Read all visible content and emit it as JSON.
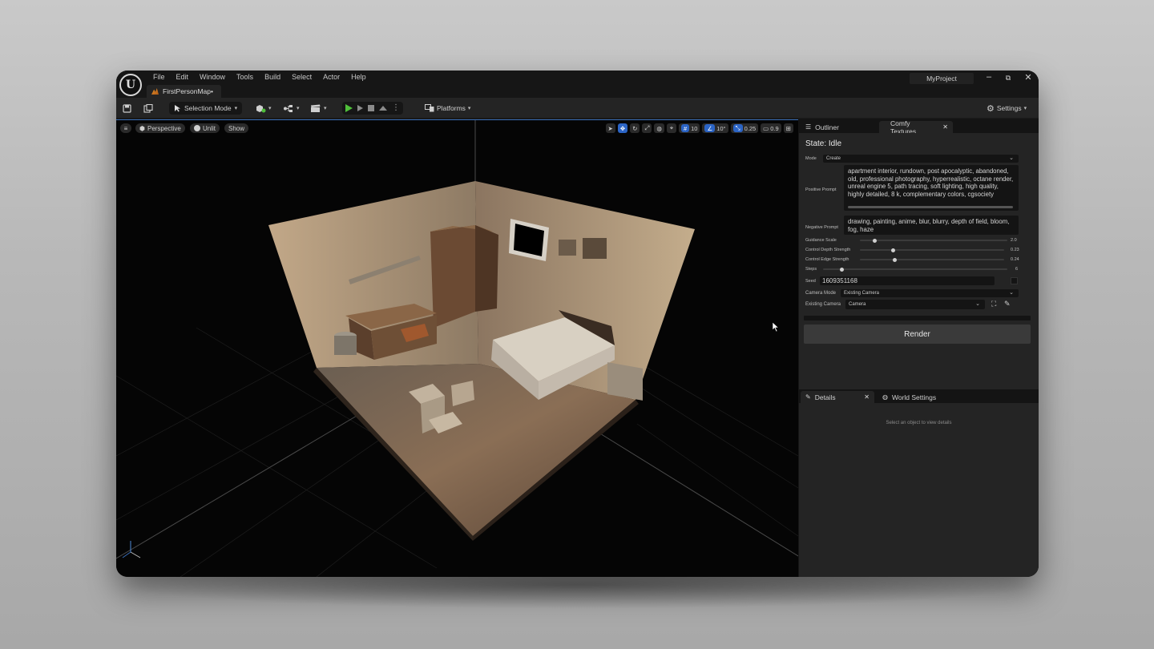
{
  "menu": [
    "File",
    "Edit",
    "Window",
    "Tools",
    "Build",
    "Select",
    "Actor",
    "Help"
  ],
  "map_tab": "FirstPersonMap•",
  "project_name": "MyProject",
  "window_controls": {
    "minimize": "–",
    "restore": "⧉",
    "close": "✕"
  },
  "toolbar": {
    "selection_mode": "Selection Mode",
    "platforms": "Platforms",
    "settings": "Settings"
  },
  "viewport": {
    "perspective": "Perspective",
    "unlit": "Unlit",
    "show": "Show",
    "grid_snap": "10",
    "rotation_snap": "10°",
    "scale_snap": "0.25",
    "camera_speed": "0.9"
  },
  "panel": {
    "outliner_tab": "Outliner",
    "comfy_tab": "Comfy Textures...",
    "state": "State: Idle",
    "mode_label": "Mode",
    "mode_value": "Create",
    "positive_label": "Positive Prompt",
    "positive_prompt": "apartment interior, rundown, post apocalyptic, abandoned, old, professional photography, hyperrealistic, octane render, unreal engine 5, path tracing, soft lighting, high quality, highly detailed, 8 k, complementary colors, cgsociety",
    "negative_label": "Negative Prompt",
    "negative_prompt": "drawing, painting, anime, blur, blurry, depth of field, bloom, fog, haze",
    "guidance_label": "Guidance Scale",
    "guidance_value": "2.0",
    "guidance_fraction": 0.1,
    "depth_label": "Control Depth Strength",
    "depth_value": "0.23",
    "depth_fraction": 0.23,
    "edge_label": "Control Edge Strength",
    "edge_value": "0.24",
    "edge_fraction": 0.24,
    "steps_label": "Steps",
    "steps_value": "6",
    "steps_fraction": 0.1,
    "seed_label": "Seed",
    "seed_value": "1609351168",
    "camera_mode_label": "Camera Mode",
    "camera_mode_value": "Existing Camera",
    "existing_camera_label": "Existing Camera",
    "existing_camera_value": "Camera",
    "render_button": "Render",
    "details_tab": "Details",
    "world_settings_tab": "World Settings",
    "details_hint": "Select an object to view details"
  },
  "colors": {
    "accent_blue": "#2b64c5",
    "play_green": "#4fbf3a",
    "panel_bg": "#242424",
    "viewport_bg": "#050505"
  }
}
